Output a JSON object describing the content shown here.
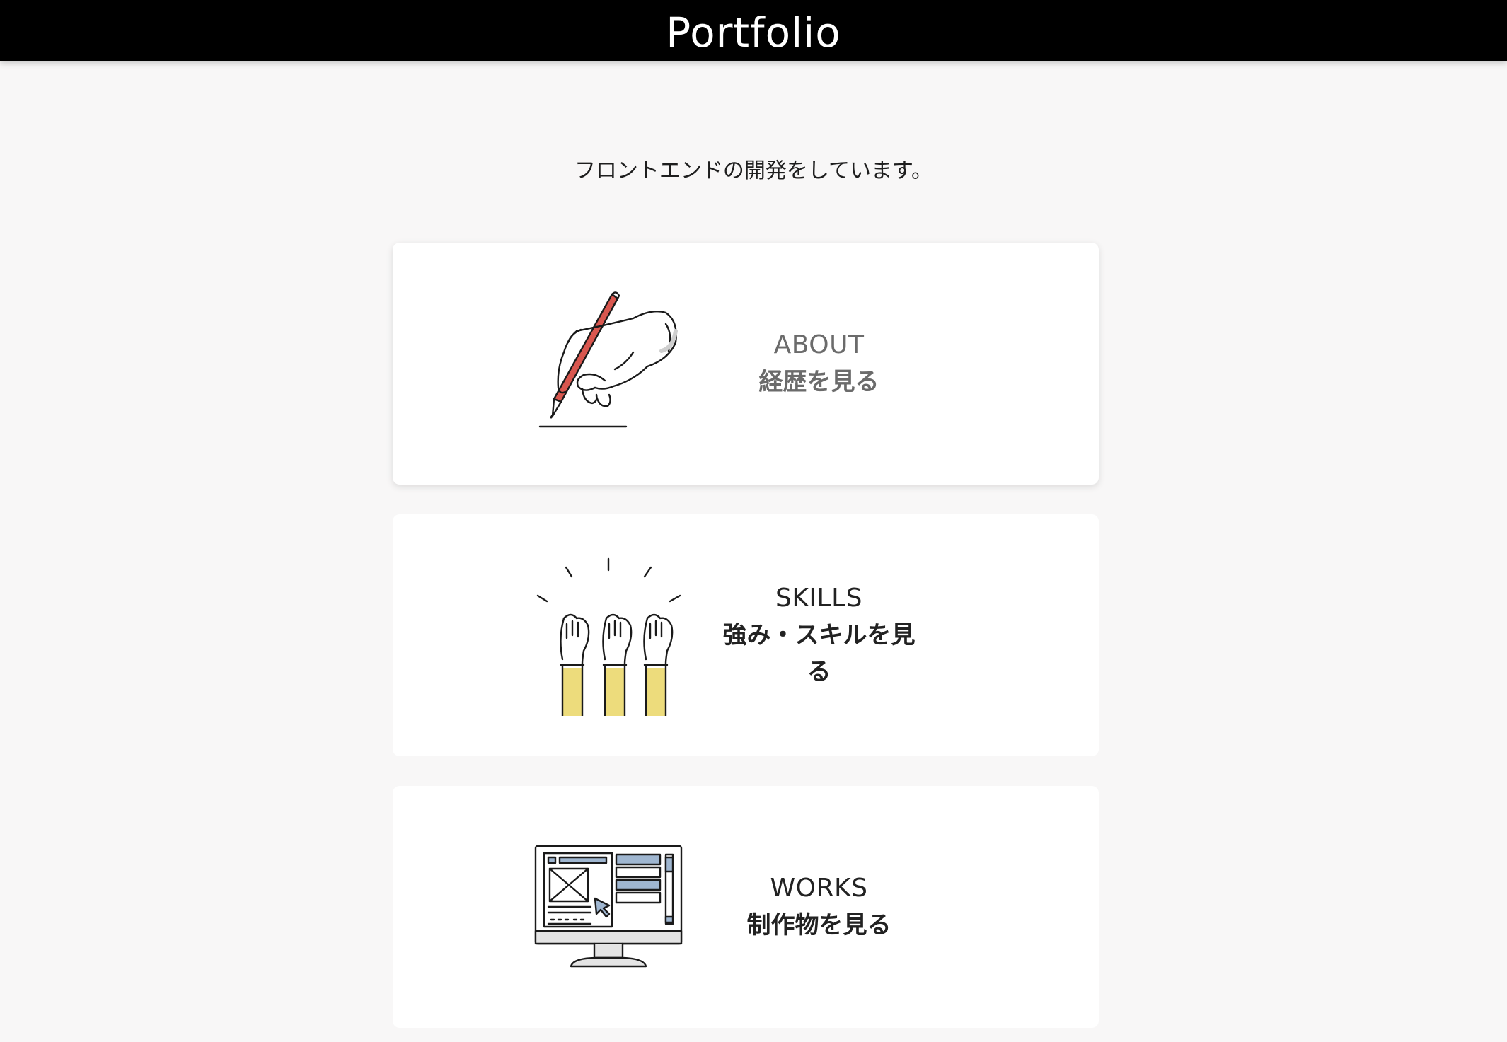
{
  "header": {
    "title": "Portfolio"
  },
  "intro": {
    "text": "フロントエンドの開発をしています。"
  },
  "cards": [
    {
      "title": "ABOUT",
      "subtitle": "経歴を見る",
      "illustration": "hand-writing-pencil-icon"
    },
    {
      "title": "SKILLS",
      "subtitle": "強み・スキルを見る",
      "illustration": "raised-hands-icon"
    },
    {
      "title": "WORKS",
      "subtitle": "制作物を見る",
      "illustration": "computer-monitor-wireframe-icon"
    }
  ],
  "colors": {
    "header_bg": "#000000",
    "page_bg": "#f8f7f7",
    "card_bg": "#ffffff",
    "pencil_red": "#d9574f",
    "sleeve_yellow": "#eddc7c",
    "screen_blue": "#9fb6d0"
  }
}
